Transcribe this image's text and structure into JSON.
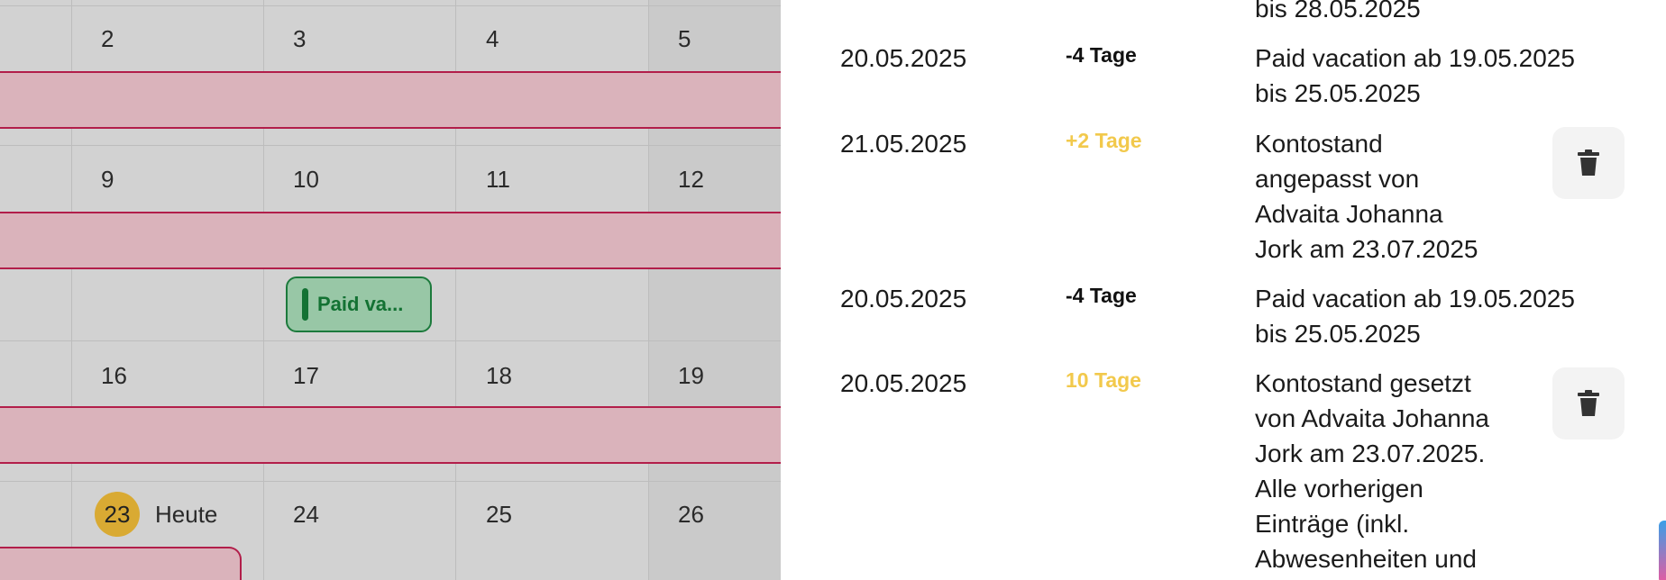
{
  "calendar": {
    "row1": {
      "d1": "2",
      "d2": "3",
      "d3": "4",
      "d4": "5"
    },
    "row2": {
      "d1": "9",
      "d2": "10",
      "d3": "11",
      "d4": "12"
    },
    "row3": {
      "d1": "16",
      "d2": "17",
      "d3": "18",
      "d4": "19"
    },
    "row4": {
      "d1": "23",
      "d2": "24",
      "d3": "25",
      "d4": "26"
    },
    "today_label": "Heute",
    "event_chip": "Paid va..."
  },
  "history": {
    "top_cut_text": "bis 28.05.2025",
    "entries": [
      {
        "date": "20.05.2025",
        "delta": "-4 Tage",
        "description": "Paid vacation ab 19.05.2025\nbis 25.05.2025"
      },
      {
        "date": "21.05.2025",
        "delta": "+2 Tage",
        "description": "Kontostand\nangepasst von\nAdvaita Johanna\nJork am 23.07.2025"
      },
      {
        "date": "20.05.2025",
        "delta": "-4 Tage",
        "description": "Paid vacation ab 19.05.2025\nbis 25.05.2025"
      },
      {
        "date": "20.05.2025",
        "delta": "10 Tage",
        "description": "Kontostand gesetzt\nvon Advaita Johanna\nJork am 23.07.2025.\nAlle vorherigen\nEinträge (inkl.\nAbwesenheiten und"
      }
    ]
  },
  "colors": {
    "holiday": "#dab3bb",
    "holiday_border": "#b21e4a",
    "today": "#d9aa33",
    "event_green": "#137233",
    "delta_positive": "#f2c94c"
  },
  "icons": {
    "delete": "trash-icon"
  }
}
